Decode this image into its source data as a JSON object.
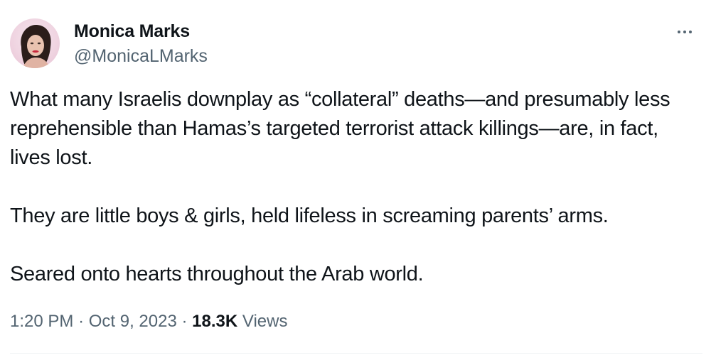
{
  "author": {
    "display_name": "Monica Marks",
    "handle": "@MonicaLMarks"
  },
  "tweet": {
    "paragraphs": [
      "What many Israelis downplay as “collateral” deaths—and presumably less reprehensible than Hamas’s targeted terrorist attack killings—are, in fact, lives lost.",
      "They are little boys & girls, held lifeless in screaming parents’ arms.",
      "Seared onto hearts throughout the Arab world."
    ],
    "time": "1:20 PM",
    "date": "Oct 9, 2023",
    "separator": "·",
    "views_count": "18.3K",
    "views_label": "Views"
  },
  "icons": {
    "more": "more-horizontal-icon",
    "avatar": "profile-photo"
  },
  "colors": {
    "text_primary": "#0f1419",
    "text_secondary": "#536471",
    "divider": "#eff3f4"
  }
}
